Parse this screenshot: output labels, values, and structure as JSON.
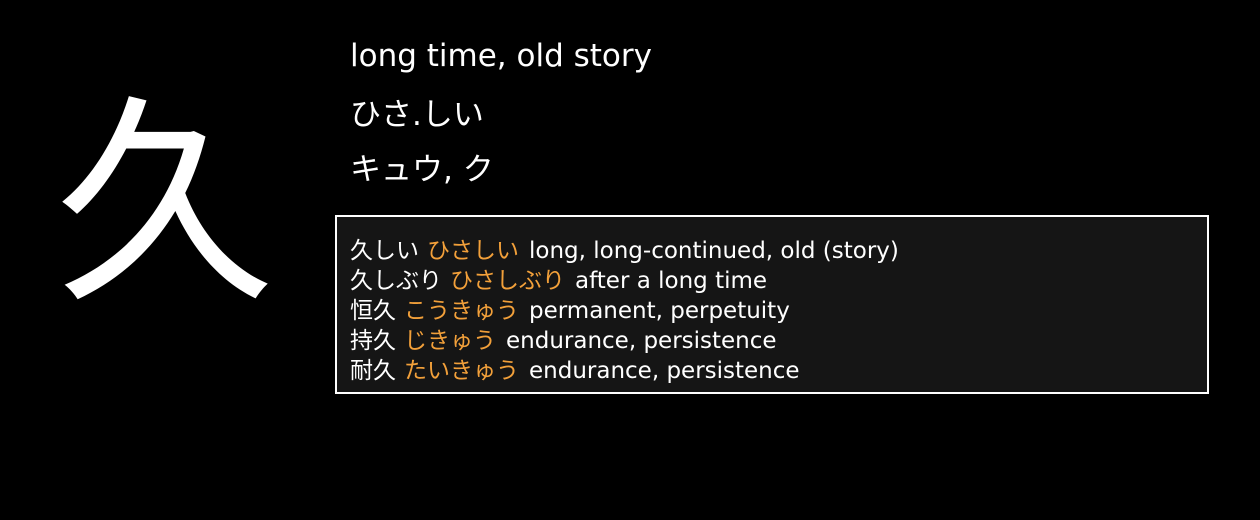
{
  "kanji": "久",
  "meaning": "long time, old story",
  "kun_reading": "ひさ.しい",
  "on_reading": "キュウ, ク",
  "colors": {
    "background": "#000000",
    "text": "#ffffff",
    "reading": "#f2a03a",
    "box_background": "#151515",
    "box_border": "#ffffff"
  },
  "vocab": [
    {
      "word": "久しい",
      "reading": "ひさしい",
      "gloss": "long, long-continued, old (story)"
    },
    {
      "word": "久しぶり",
      "reading": "ひさしぶり",
      "gloss": "after a long time"
    },
    {
      "word": "恒久",
      "reading": "こうきゅう",
      "gloss": "permanent, perpetuity"
    },
    {
      "word": "持久",
      "reading": "じきゅう",
      "gloss": "endurance, persistence"
    },
    {
      "word": "耐久",
      "reading": "たいきゅう",
      "gloss": "endurance, persistence"
    }
  ]
}
